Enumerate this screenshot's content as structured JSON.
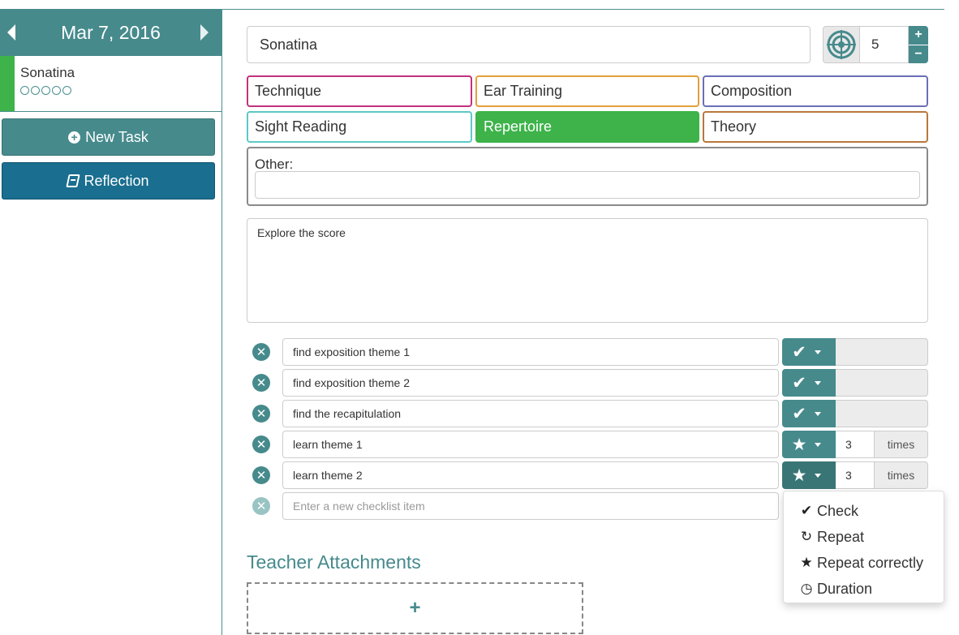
{
  "sidebar": {
    "date": "Mar 7, 2016",
    "task": {
      "title": "Sonatina",
      "rating_total": 5,
      "rating_filled": 0
    },
    "new_task_label": "New Task",
    "reflection_label": "Reflection"
  },
  "task": {
    "title": "Sonatina",
    "target_value": "5",
    "categories": [
      {
        "label": "Technique",
        "color": "#c2317d",
        "selected": false
      },
      {
        "label": "Ear Training",
        "color": "#e3a03a",
        "selected": false
      },
      {
        "label": "Composition",
        "color": "#6a6fb5",
        "selected": false
      },
      {
        "label": "Sight Reading",
        "color": "#5cc9c6",
        "selected": false
      },
      {
        "label": "Repertoire",
        "color": "#3db34a",
        "selected": true
      },
      {
        "label": "Theory",
        "color": "#b9773a",
        "selected": false
      }
    ],
    "other_label": "Other:",
    "other_value": "",
    "notes": "Explore the score"
  },
  "checklist": {
    "items": [
      {
        "text": "find exposition theme 1",
        "type": "check"
      },
      {
        "text": "find exposition theme 2",
        "type": "check"
      },
      {
        "text": "find the recapitulation",
        "type": "check"
      },
      {
        "text": "learn theme 1",
        "type": "repeat-correctly",
        "count": "3",
        "unit": "times"
      },
      {
        "text": "learn theme 2",
        "type": "repeat-correctly",
        "count": "3",
        "unit": "times"
      }
    ],
    "new_item_placeholder": "Enter a new checklist item"
  },
  "type_menu": {
    "items": [
      {
        "label": "Check",
        "icon": "check-icon"
      },
      {
        "label": "Repeat",
        "icon": "repeat-icon"
      },
      {
        "label": "Repeat correctly",
        "icon": "star-icon"
      },
      {
        "label": "Duration",
        "icon": "clock-icon"
      }
    ]
  },
  "attachments": {
    "title": "Teacher Attachments",
    "add_symbol": "+"
  },
  "colors": {
    "accent": "#468a8c",
    "reflection": "#1a6e8f",
    "stripe": "#3db34a"
  }
}
